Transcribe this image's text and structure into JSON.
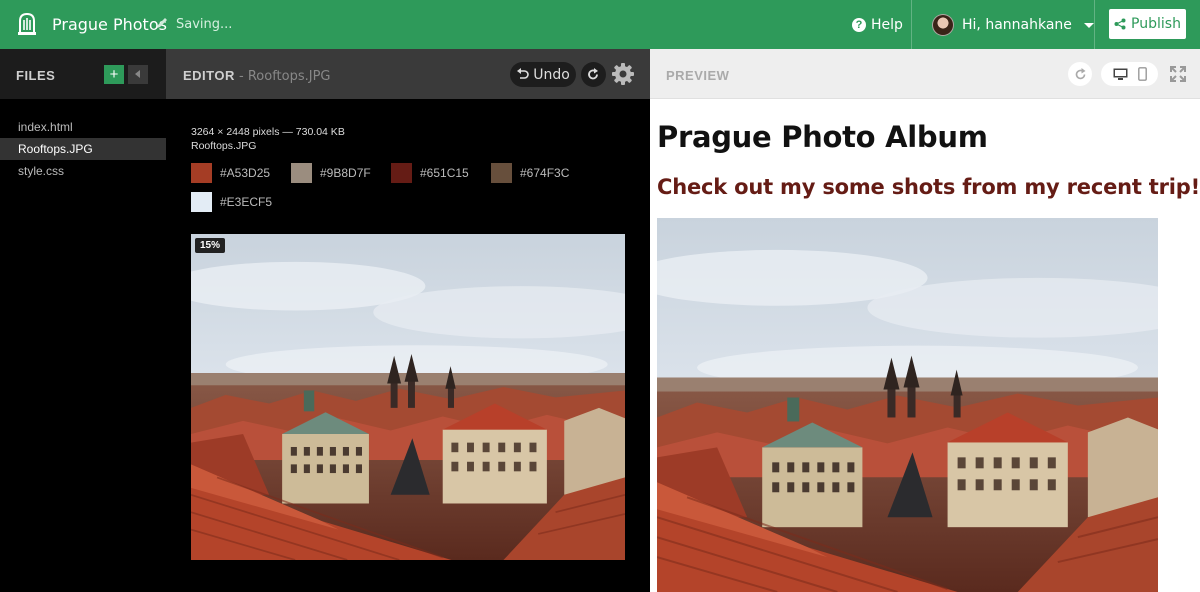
{
  "topbar": {
    "project_name": "Prague Photos",
    "status": "Saving...",
    "help_label": "Help",
    "user_label": "Hi, hannahkane",
    "publish_label": "Publish"
  },
  "files": {
    "title": "FILES",
    "add_label": "+",
    "items": [
      {
        "name": "index.html",
        "active": false
      },
      {
        "name": "Rooftops.JPG",
        "active": true
      },
      {
        "name": "style.css",
        "active": false
      }
    ]
  },
  "editor": {
    "title": "EDITOR",
    "filename": " - Rooftops.JPG",
    "undo_label": "Undo",
    "image_info": "3264 × 2448 pixels — 730.04 KB",
    "image_name": "Rooftops.JPG",
    "palette": [
      {
        "hex": "#A53D25"
      },
      {
        "hex": "#9B8D7F"
      },
      {
        "hex": "#651C15"
      },
      {
        "hex": "#674F3C"
      },
      {
        "hex": "#E3ECF5"
      }
    ],
    "zoom": "15%"
  },
  "preview": {
    "title": "PREVIEW",
    "heading": "Prague Photo Album",
    "subheading": "Check out my some shots from my recent trip!"
  },
  "colors": {
    "brand_green": "#2e9a5a",
    "subheading": "#651c15"
  },
  "icons": [
    "logo-icon",
    "pencil-icon",
    "help-icon",
    "chevron-down-icon",
    "share-icon",
    "chevron-left-icon",
    "undo-icon",
    "redo-icon",
    "gear-icon",
    "refresh-icon",
    "desktop-icon",
    "mobile-icon",
    "fullscreen-icon"
  ]
}
